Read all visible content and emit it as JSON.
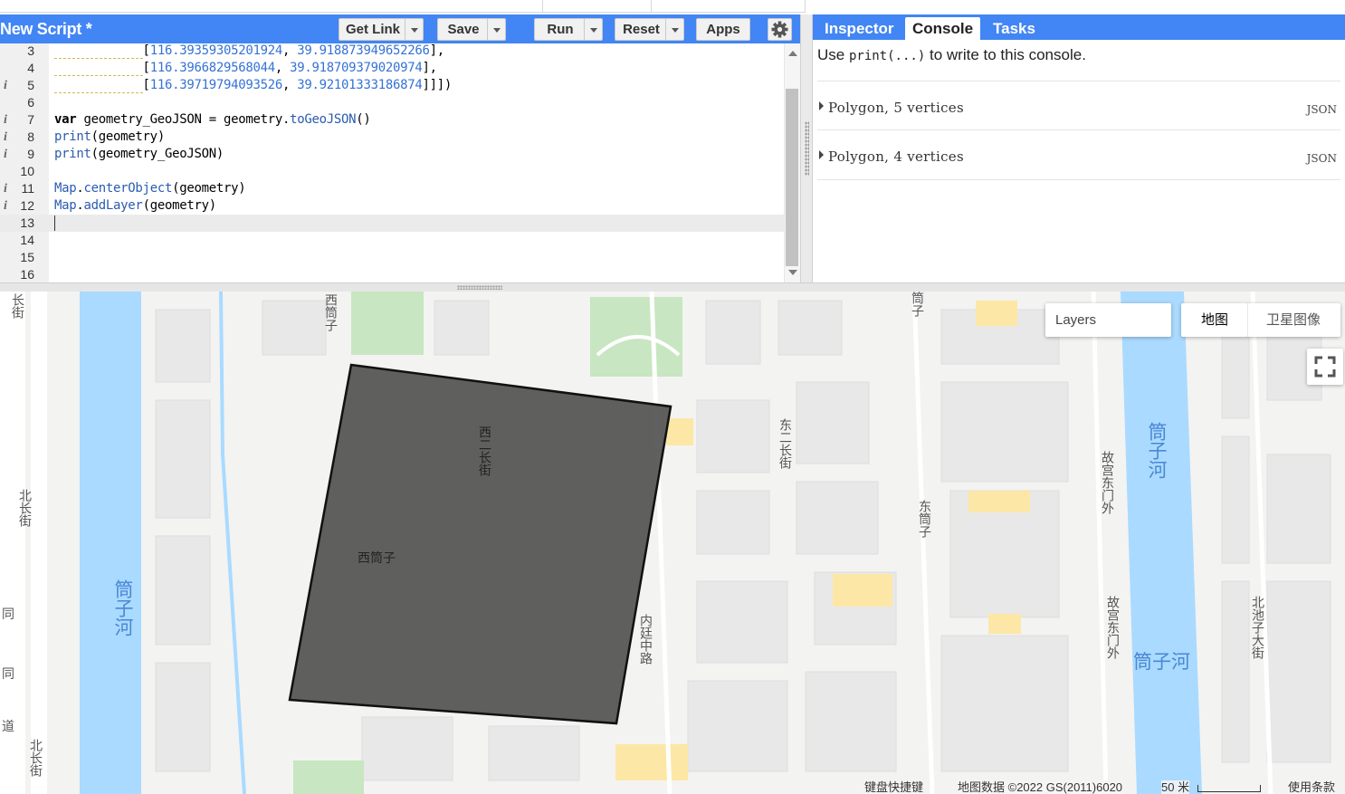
{
  "editor": {
    "script_title": "New Script *",
    "buttons": {
      "get_link": "Get Link",
      "save": "Save",
      "run": "Run",
      "reset": "Reset",
      "apps": "Apps"
    },
    "lines": [
      {
        "n": "3",
        "info": "",
        "code": "[116.39359305201924, 39.918873949652266],"
      },
      {
        "n": "4",
        "info": "",
        "code": "[116.3966829568044, 39.918709379020974],"
      },
      {
        "n": "5",
        "info": "i",
        "code": "[116.39719794093526, 39.92101333186874]]])"
      },
      {
        "n": "6",
        "info": "",
        "code": ""
      },
      {
        "n": "7",
        "info": "i",
        "code": "var geometry_GeoJSON = geometry.toGeoJSON()"
      },
      {
        "n": "8",
        "info": "i",
        "code": "print(geometry)"
      },
      {
        "n": "9",
        "info": "i",
        "code": "print(geometry_GeoJSON)"
      },
      {
        "n": "10",
        "info": "",
        "code": ""
      },
      {
        "n": "11",
        "info": "i",
        "code": "Map.centerObject(geometry)"
      },
      {
        "n": "12",
        "info": "i",
        "code": "Map.addLayer(geometry)"
      },
      {
        "n": "13",
        "info": "",
        "code": ""
      },
      {
        "n": "14",
        "info": "",
        "code": ""
      },
      {
        "n": "15",
        "info": "",
        "code": ""
      },
      {
        "n": "16",
        "info": "",
        "code": ""
      }
    ]
  },
  "right_panel": {
    "tabs": [
      "Inspector",
      "Console",
      "Tasks"
    ],
    "active_tab": "Console",
    "console": {
      "msg_prefix": "Use",
      "msg_code": "print(...)",
      "msg_suffix": "to write to this console.",
      "rows": [
        {
          "text": "Polygon, 5 vertices",
          "badge": "JSON"
        },
        {
          "text": "Polygon, 4 vertices",
          "badge": "JSON"
        }
      ]
    }
  },
  "map": {
    "layers_label": "Layers",
    "map_types": [
      "地图",
      "卫星图像"
    ],
    "labels": {
      "xijianzi_top": "西筒子",
      "jianzi_top": "筒子",
      "changjie_top": "长街",
      "xier_changjie": "西二长街",
      "dong_er_changjie": "东二长街",
      "xijianzi": "西筒子",
      "dongjianzi": "东筒子",
      "neiting_zhonglu": "内廷中路",
      "gugong_dongmenwai_1": "故宫东门外",
      "gugong_dongmenwai_2": "故宫东门外",
      "tongzihe_left": "筒子河",
      "tongzihe_right_v": "筒子河",
      "tongzihe_right_h": "筒子河",
      "beichangjie_1": "北长街",
      "beichangjie_2": "北长街",
      "beichizi_dajie": "北池子大街",
      "tong_1": "同",
      "tong_2": "同",
      "dao": "道"
    },
    "footer": {
      "shortcuts": "键盘快捷键",
      "data": "地图数据 ©2022 GS(2011)6020",
      "scale": "50 米",
      "terms": "使用条款"
    },
    "colors": {
      "accent": "#4285f4",
      "water": "#aadaff",
      "park": "#c8e6c1",
      "polygon_fill": "#444444"
    }
  }
}
